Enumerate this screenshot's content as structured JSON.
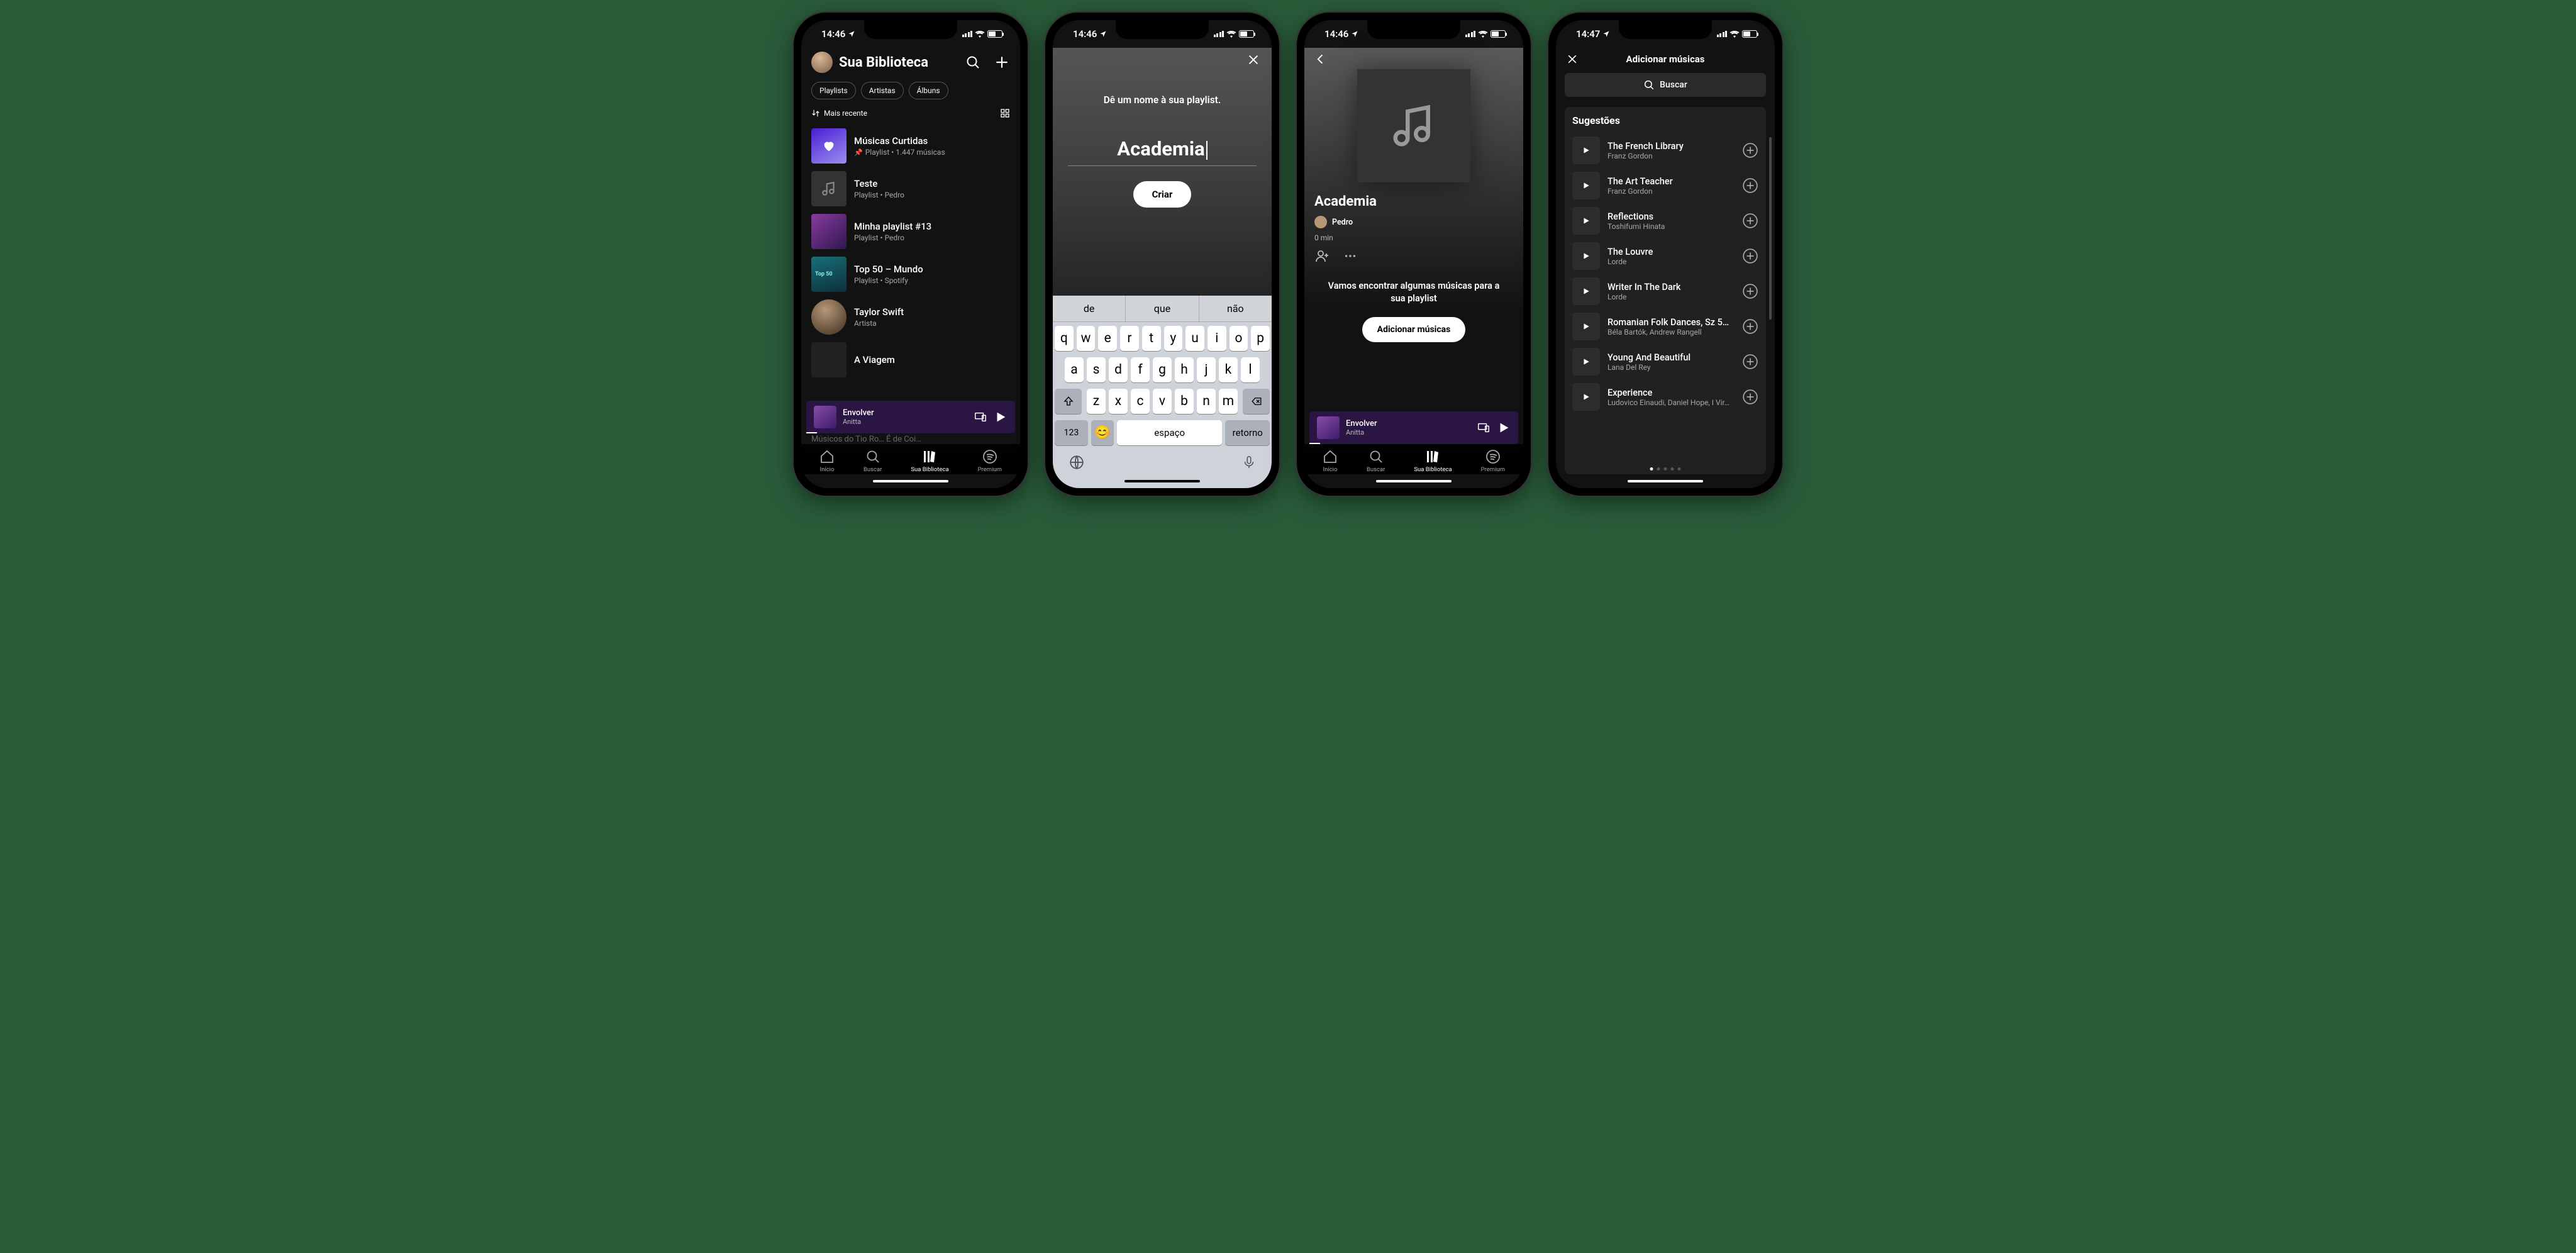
{
  "status": {
    "time1": "14:46",
    "time4": "14:47"
  },
  "screen1": {
    "title": "Sua Biblioteca",
    "chips": [
      "Playlists",
      "Artistas",
      "Álbuns"
    ],
    "sort": "Mais recente",
    "items": [
      {
        "title": "Músicas Curtidas",
        "sub": "Playlist • 1.447 músicas",
        "pinned": true,
        "type": "liked"
      },
      {
        "title": "Teste",
        "sub": "Playlist • Pedro",
        "type": "generic"
      },
      {
        "title": "Minha playlist #13",
        "sub": "Playlist • Pedro",
        "type": "anitta"
      },
      {
        "title": "Top 50 – Mundo",
        "sub": "Playlist • Spotify",
        "type": "top50"
      },
      {
        "title": "Taylor Swift",
        "sub": "Artista",
        "type": "artist"
      },
      {
        "title": "A Viagem",
        "sub": "",
        "type": "generic"
      }
    ],
    "hidden_item": "Músicos do Tio Ro… É de Coi…"
  },
  "nowplaying": {
    "title": "Envolver",
    "artist": "Anitta"
  },
  "tabs": {
    "home": "Início",
    "search": "Buscar",
    "library": "Sua Biblioteca",
    "premium": "Premium"
  },
  "screen2": {
    "prompt": "Dê um nome à sua playlist.",
    "input": "Academia",
    "create": "Criar",
    "suggestions": [
      "de",
      "que",
      "não"
    ],
    "rows": [
      [
        "q",
        "w",
        "e",
        "r",
        "t",
        "y",
        "u",
        "i",
        "o",
        "p"
      ],
      [
        "a",
        "s",
        "d",
        "f",
        "g",
        "h",
        "j",
        "k",
        "l"
      ],
      [
        "z",
        "x",
        "c",
        "v",
        "b",
        "n",
        "m"
      ]
    ],
    "numkey": "123",
    "space": "espaço",
    "return": "retorno"
  },
  "screen3": {
    "title": "Academia",
    "owner": "Pedro",
    "duration": "0 min",
    "msg": "Vamos encontrar algumas músicas para a sua playlist",
    "button": "Adicionar músicas"
  },
  "screen4": {
    "header": "Adicionar músicas",
    "search": "Buscar",
    "section": "Sugestões",
    "items": [
      {
        "title": "The French Library",
        "sub": "Franz Gordon"
      },
      {
        "title": "The Art Teacher",
        "sub": "Franz Gordon"
      },
      {
        "title": "Reflections",
        "sub": "Toshifumi Hinata"
      },
      {
        "title": "The Louvre",
        "sub": "Lorde"
      },
      {
        "title": "Writer In The Dark",
        "sub": "Lorde"
      },
      {
        "title": "Romanian Folk Dances, Sz 5…",
        "sub": "Béla Bartók, Andrew Rangell"
      },
      {
        "title": "Young And Beautiful",
        "sub": "Lana Del Rey"
      },
      {
        "title": "Experience",
        "sub": "Ludovico Einaudi, Daniel Hope, I Vir…"
      }
    ]
  }
}
